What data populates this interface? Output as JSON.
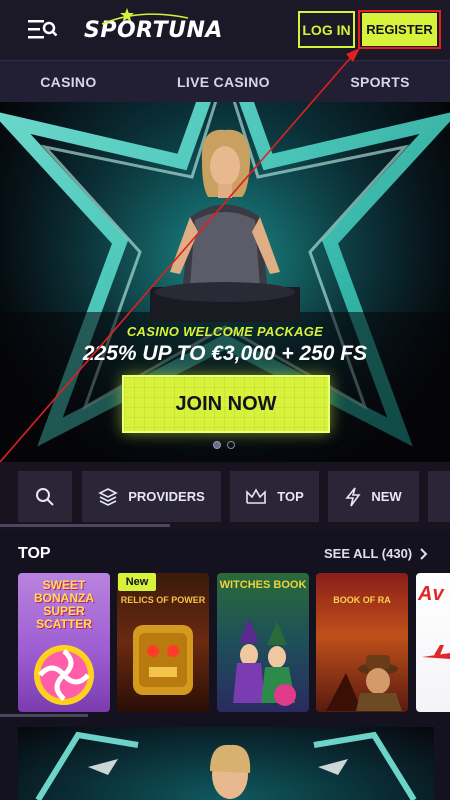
{
  "header": {
    "logo_text": "SPORTUNA",
    "login_label": "LOG IN",
    "register_label": "REGISTER",
    "accent_color": "#d6f23a",
    "icons": {
      "menu": "menu-search-icon",
      "logo_star": "star-icon"
    }
  },
  "nav": {
    "items": [
      {
        "label": "CASINO"
      },
      {
        "label": "LIVE CASINO"
      },
      {
        "label": "SPORTS"
      }
    ]
  },
  "hero": {
    "subtitle": "CASINO WELCOME PACKAGE",
    "title": "225% UP TO €3,000 + 250 FS",
    "cta_label": "JOIN NOW",
    "slides_total": 2,
    "active_slide": 1
  },
  "filters": {
    "items": [
      {
        "label": "",
        "icon": "search-icon"
      },
      {
        "label": "PROVIDERS",
        "icon": "layers-icon"
      },
      {
        "label": "TOP",
        "icon": "crown-icon"
      },
      {
        "label": "NEW",
        "icon": "lightning-icon"
      }
    ]
  },
  "top_section": {
    "title": "TOP",
    "see_all_label": "SEE ALL (430)",
    "games": [
      {
        "name": "SWEET BONANZA SUPER SCATTER"
      },
      {
        "name": "RELICS OF POWER",
        "badge": "New"
      },
      {
        "name": "WITCHES BOOK"
      },
      {
        "name": "BOOK OF RA"
      },
      {
        "name": "AVIATOR"
      }
    ],
    "badge_new": "New"
  },
  "annotation": {
    "color": "#e02020"
  }
}
